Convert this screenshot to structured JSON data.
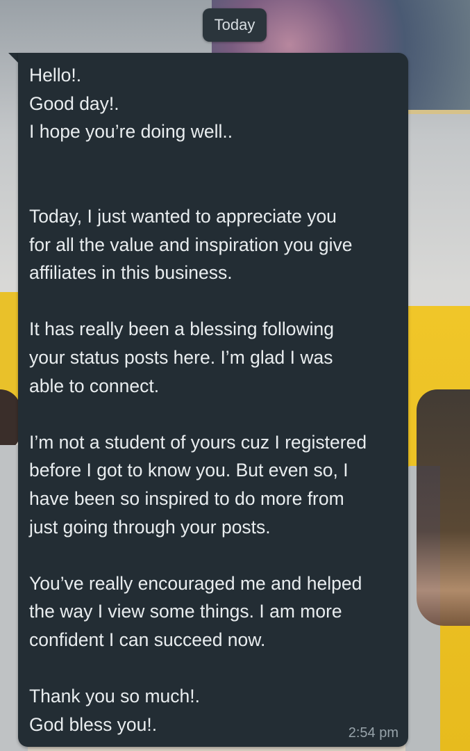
{
  "chat": {
    "date_separator": "Today",
    "message": {
      "text": "Hello!.\nGood day!.\nI hope you’re doing well..\n\n\nToday, I just wanted to appreciate you\nfor all the value and inspiration you give\naffiliates in this business.\n\nIt has really been a blessing following\nyour status posts here. I’m glad I was\nable to connect.\n\nI’m not a student of yours cuz I registered\nbefore I got to know you. But even so, I\nhave been so inspired to do more from\njust going through your posts.\n\nYou’ve really encouraged me and helped\nthe way I view some things. I am more\nconfident I can succeed now.\n\nThank you so much!.\nGod bless you!.",
      "time": "2:54 pm"
    }
  },
  "colors": {
    "bubble_bg": "#232d34",
    "text": "#e9edef",
    "timestamp": "#97a3aa",
    "chip_bg": "#2b353c"
  }
}
